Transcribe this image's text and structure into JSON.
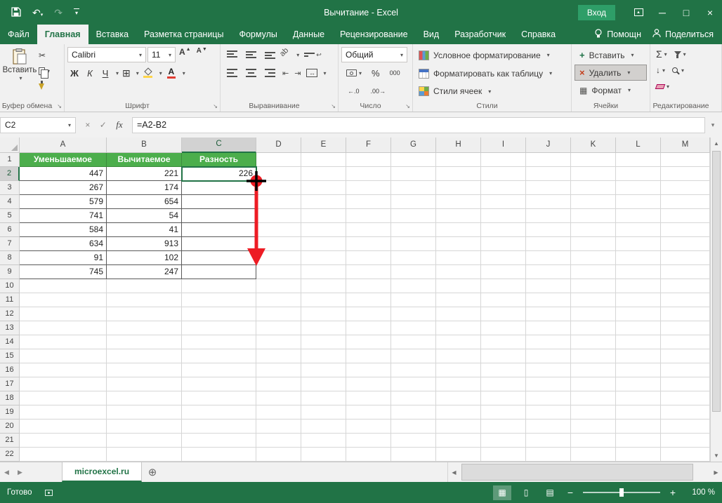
{
  "titlebar": {
    "title": "Вычитание - Excel",
    "signin_label": "Вход"
  },
  "ribbon_tabs": [
    {
      "label": "Файл",
      "active": false
    },
    {
      "label": "Главная",
      "active": true
    },
    {
      "label": "Вставка",
      "active": false
    },
    {
      "label": "Разметка страницы",
      "active": false
    },
    {
      "label": "Формулы",
      "active": false
    },
    {
      "label": "Данные",
      "active": false
    },
    {
      "label": "Рецензирование",
      "active": false
    },
    {
      "label": "Вид",
      "active": false
    },
    {
      "label": "Разработчик",
      "active": false
    },
    {
      "label": "Справка",
      "active": false
    }
  ],
  "tabrow_right": {
    "tellme": "Помощн",
    "share": "Поделиться"
  },
  "ribbon": {
    "clipboard": {
      "label": "Буфер обмена",
      "paste_label": "Вставить"
    },
    "font": {
      "label": "Шрифт",
      "name": "Calibri",
      "size": "11",
      "bold": "Ж",
      "italic": "К",
      "underline": "Ч",
      "grow": "А",
      "shrink": "А",
      "color_letter": "А"
    },
    "alignment": {
      "label": "Выравнивание"
    },
    "number": {
      "label": "Число",
      "format": "Общий",
      "percent": "%",
      "thousands": "000"
    },
    "styles": {
      "label": "Стили",
      "items": [
        "Условное форматирование",
        "Форматировать как таблицу",
        "Стили ячеек"
      ]
    },
    "cells": {
      "label": "Ячейки",
      "items": [
        "Вставить",
        "Удалить",
        "Формат"
      ]
    },
    "editing": {
      "label": "Редактирование",
      "sum_label": "Σ"
    }
  },
  "formula_bar": {
    "name_box": "C2",
    "fx_label": "fx",
    "formula": "=A2-B2"
  },
  "grid": {
    "columns": [
      "A",
      "B",
      "C",
      "D",
      "E",
      "F",
      "G",
      "H",
      "I",
      "J",
      "K",
      "L",
      "M"
    ],
    "row_count": 22,
    "header_row": [
      "Уменьшаемое",
      "Вычитаемое",
      "Разность"
    ],
    "rows": [
      [
        "447",
        "221",
        "226"
      ],
      [
        "267",
        "174",
        ""
      ],
      [
        "579",
        "654",
        ""
      ],
      [
        "741",
        "54",
        ""
      ],
      [
        "584",
        "41",
        ""
      ],
      [
        "634",
        "913",
        ""
      ],
      [
        "91",
        "102",
        ""
      ],
      [
        "745",
        "247",
        ""
      ]
    ],
    "selected_cell": "C2"
  },
  "sheet_tab": {
    "name": "microexcel.ru"
  },
  "status_bar": {
    "ready": "Готово",
    "zoom": "100 %"
  }
}
